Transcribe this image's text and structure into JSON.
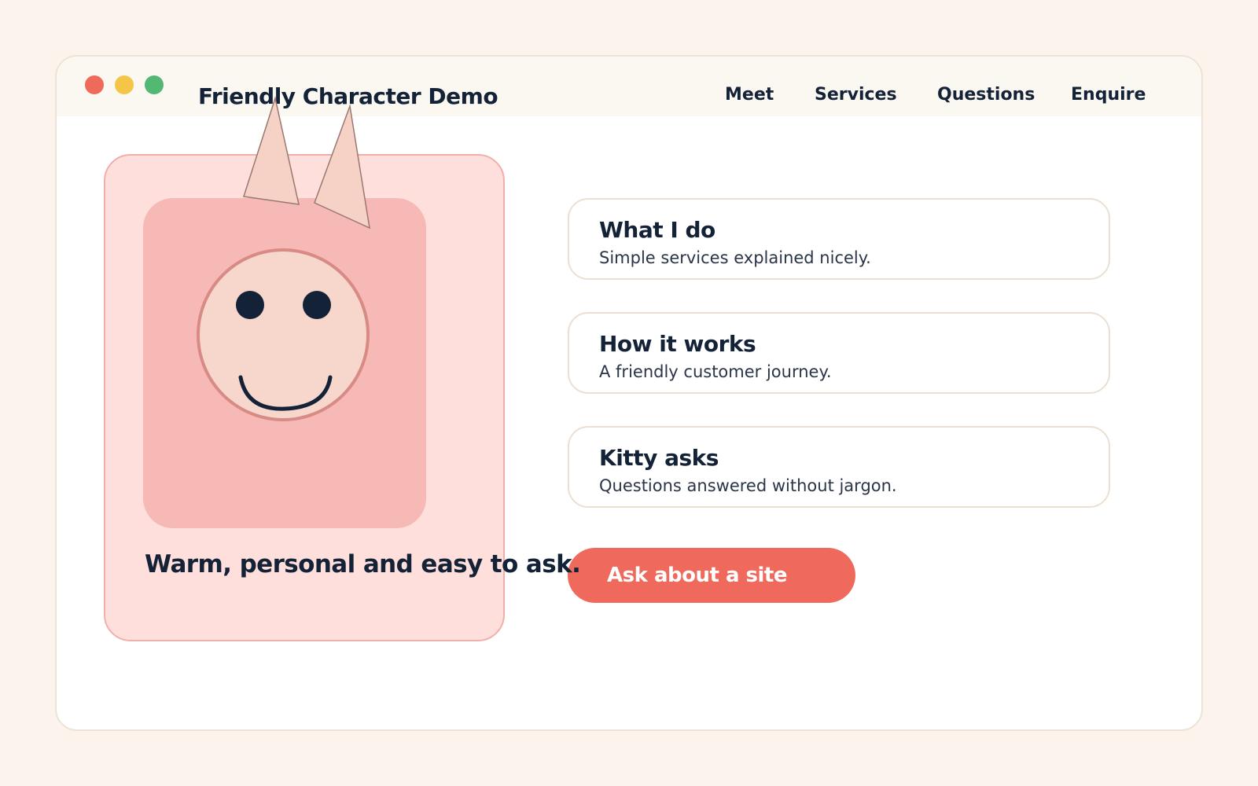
{
  "window": {
    "title": "Friendly Character Demo",
    "controls": [
      "close",
      "minimize",
      "maximize"
    ]
  },
  "nav": {
    "items": [
      {
        "label": "Meet"
      },
      {
        "label": "Services"
      },
      {
        "label": "Questions"
      },
      {
        "label": "Enquire"
      }
    ]
  },
  "character": {
    "icon": "cat-face-icon",
    "tagline": "Warm, personal and easy to ask."
  },
  "cards": [
    {
      "title": "What I do",
      "subtitle": "Simple services explained nicely."
    },
    {
      "title": "How it works",
      "subtitle": "A friendly customer journey."
    },
    {
      "title": "Kitty asks",
      "subtitle": "Questions answered without jargon."
    }
  ],
  "cta": {
    "label": "Ask about a site"
  },
  "colors": {
    "background": "#fcf4ec",
    "accent": "#ef6a5c",
    "text": "#142238",
    "card_pink": "#ffdfdb",
    "character_body": "#f7b9b6",
    "face": "#f7d6cc"
  }
}
